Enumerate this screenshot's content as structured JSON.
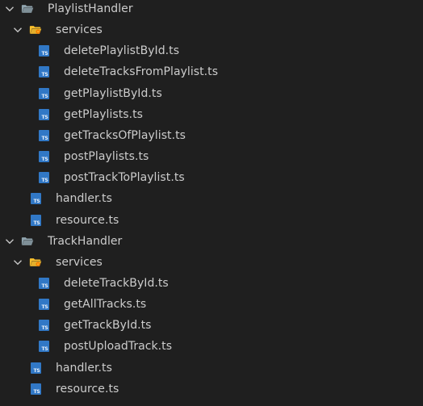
{
  "explorer": {
    "nodes": [
      {
        "label": "PlaylistHandler",
        "kind": "folder",
        "expanded": true,
        "depth": 0,
        "icon": "folder-open-icon"
      },
      {
        "label": "services",
        "kind": "services-folder",
        "expanded": true,
        "depth": 1,
        "icon": "services-folder-icon"
      },
      {
        "label": "deletePlaylistById.ts",
        "kind": "ts-file",
        "depth": 2,
        "icon": "typescript-file-icon"
      },
      {
        "label": "deleteTracksFromPlaylist.ts",
        "kind": "ts-file",
        "depth": 2,
        "icon": "typescript-file-icon"
      },
      {
        "label": "getPlaylistById.ts",
        "kind": "ts-file",
        "depth": 2,
        "icon": "typescript-file-icon"
      },
      {
        "label": "getPlaylists.ts",
        "kind": "ts-file",
        "depth": 2,
        "icon": "typescript-file-icon"
      },
      {
        "label": "getTracksOfPlaylist.ts",
        "kind": "ts-file",
        "depth": 2,
        "icon": "typescript-file-icon"
      },
      {
        "label": "postPlaylists.ts",
        "kind": "ts-file",
        "depth": 2,
        "icon": "typescript-file-icon"
      },
      {
        "label": "postTrackToPlaylist.ts",
        "kind": "ts-file",
        "depth": 2,
        "icon": "typescript-file-icon"
      },
      {
        "label": "handler.ts",
        "kind": "ts-file",
        "depth": 1,
        "icon": "typescript-file-icon"
      },
      {
        "label": "resource.ts",
        "kind": "ts-file",
        "depth": 1,
        "icon": "typescript-file-icon"
      },
      {
        "label": "TrackHandler",
        "kind": "folder",
        "expanded": true,
        "depth": 0,
        "icon": "folder-open-icon"
      },
      {
        "label": "services",
        "kind": "services-folder",
        "expanded": true,
        "depth": 1,
        "icon": "services-folder-icon"
      },
      {
        "label": "deleteTrackById.ts",
        "kind": "ts-file",
        "depth": 2,
        "icon": "typescript-file-icon"
      },
      {
        "label": "getAllTracks.ts",
        "kind": "ts-file",
        "depth": 2,
        "icon": "typescript-file-icon"
      },
      {
        "label": "getTrackById.ts",
        "kind": "ts-file",
        "depth": 2,
        "icon": "typescript-file-icon"
      },
      {
        "label": "postUploadTrack.ts",
        "kind": "ts-file",
        "depth": 2,
        "icon": "typescript-file-icon"
      },
      {
        "label": "handler.ts",
        "kind": "ts-file",
        "depth": 1,
        "icon": "typescript-file-icon"
      },
      {
        "label": "resource.ts",
        "kind": "ts-file",
        "depth": 1,
        "icon": "typescript-file-icon"
      }
    ],
    "ts_badge": "TS"
  },
  "colors": {
    "background": "#1f1f1f",
    "text": "#cccccc",
    "chevron": "#c5c5c5",
    "folder": "#90a4ae",
    "services_folder": "#fbc02d",
    "services_gear": "#f57c00",
    "typescript": "#3178c6"
  }
}
